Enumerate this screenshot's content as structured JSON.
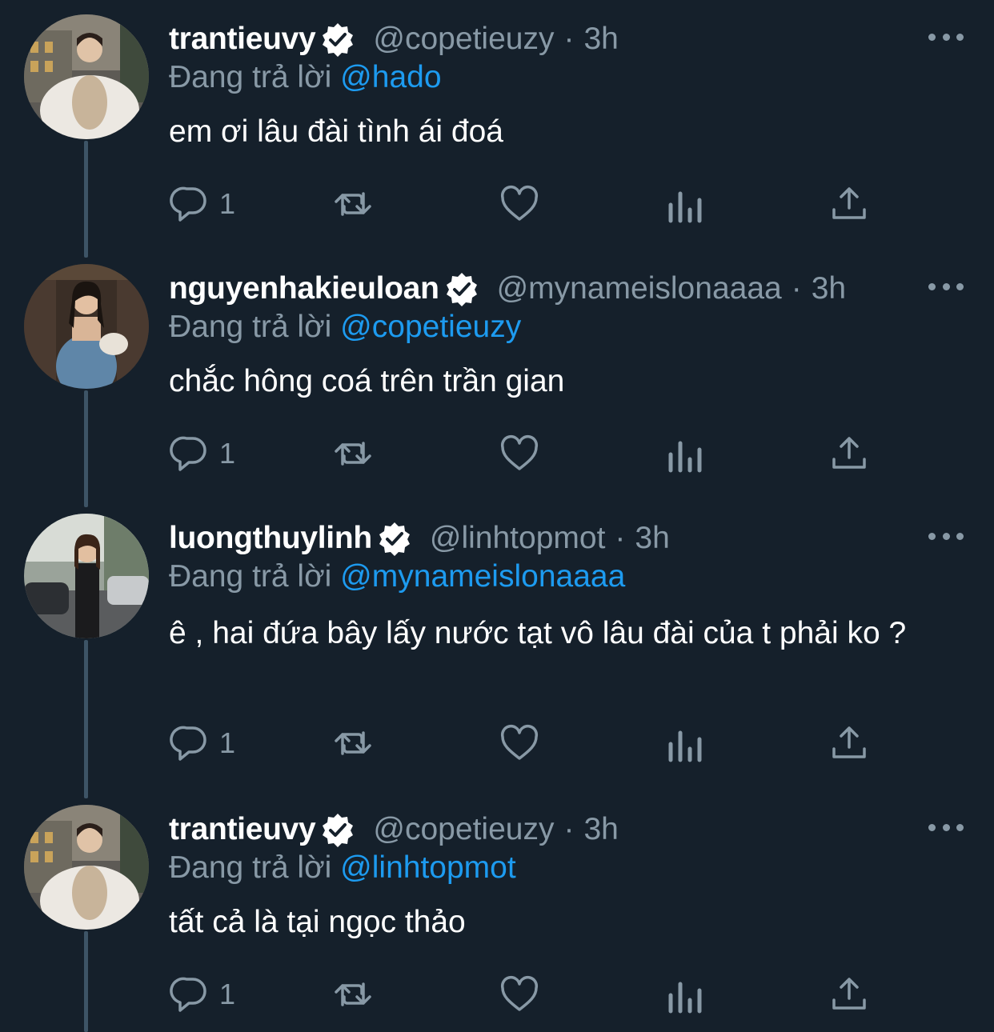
{
  "tweets": [
    {
      "display_name": "trantieuvy",
      "handle": "@copetieuzy",
      "time": "3h",
      "reply_prefix": "Đang trả lời",
      "reply_to": "@hado",
      "text": "em ơi lâu đài tình ái đoá",
      "reply_count": "1"
    },
    {
      "display_name": "nguyenhakieuloan",
      "handle": "@mynameislonaaaa",
      "time": "3h",
      "reply_prefix": "Đang trả lời",
      "reply_to": "@copetieuzy",
      "text": "chắc hông coá trên trần gian",
      "reply_count": "1"
    },
    {
      "display_name": "luongthuylinh",
      "handle": "@linhtopmot",
      "time": "3h",
      "reply_prefix": "Đang trả lời",
      "reply_to": "@mynameislonaaaa",
      "text": "ê , hai đứa bây lấy nước tạt vô lâu đài của t phải ko ?",
      "reply_count": "1"
    },
    {
      "display_name": "trantieuvy",
      "handle": "@copetieuzy",
      "time": "3h",
      "reply_prefix": "Đang trả lời",
      "reply_to": "@linhtopmot",
      "text": "tất cả là tại ngọc thảo",
      "reply_count": "1"
    }
  ],
  "separator": "·",
  "colors": {
    "background": "#15202b",
    "secondary_text": "#8899a6",
    "link": "#1d9bf0",
    "thread_line": "#3d5466"
  },
  "icons": [
    "verified-badge-icon",
    "more-icon",
    "reply-icon",
    "retweet-icon",
    "like-icon",
    "analytics-icon",
    "share-icon"
  ]
}
